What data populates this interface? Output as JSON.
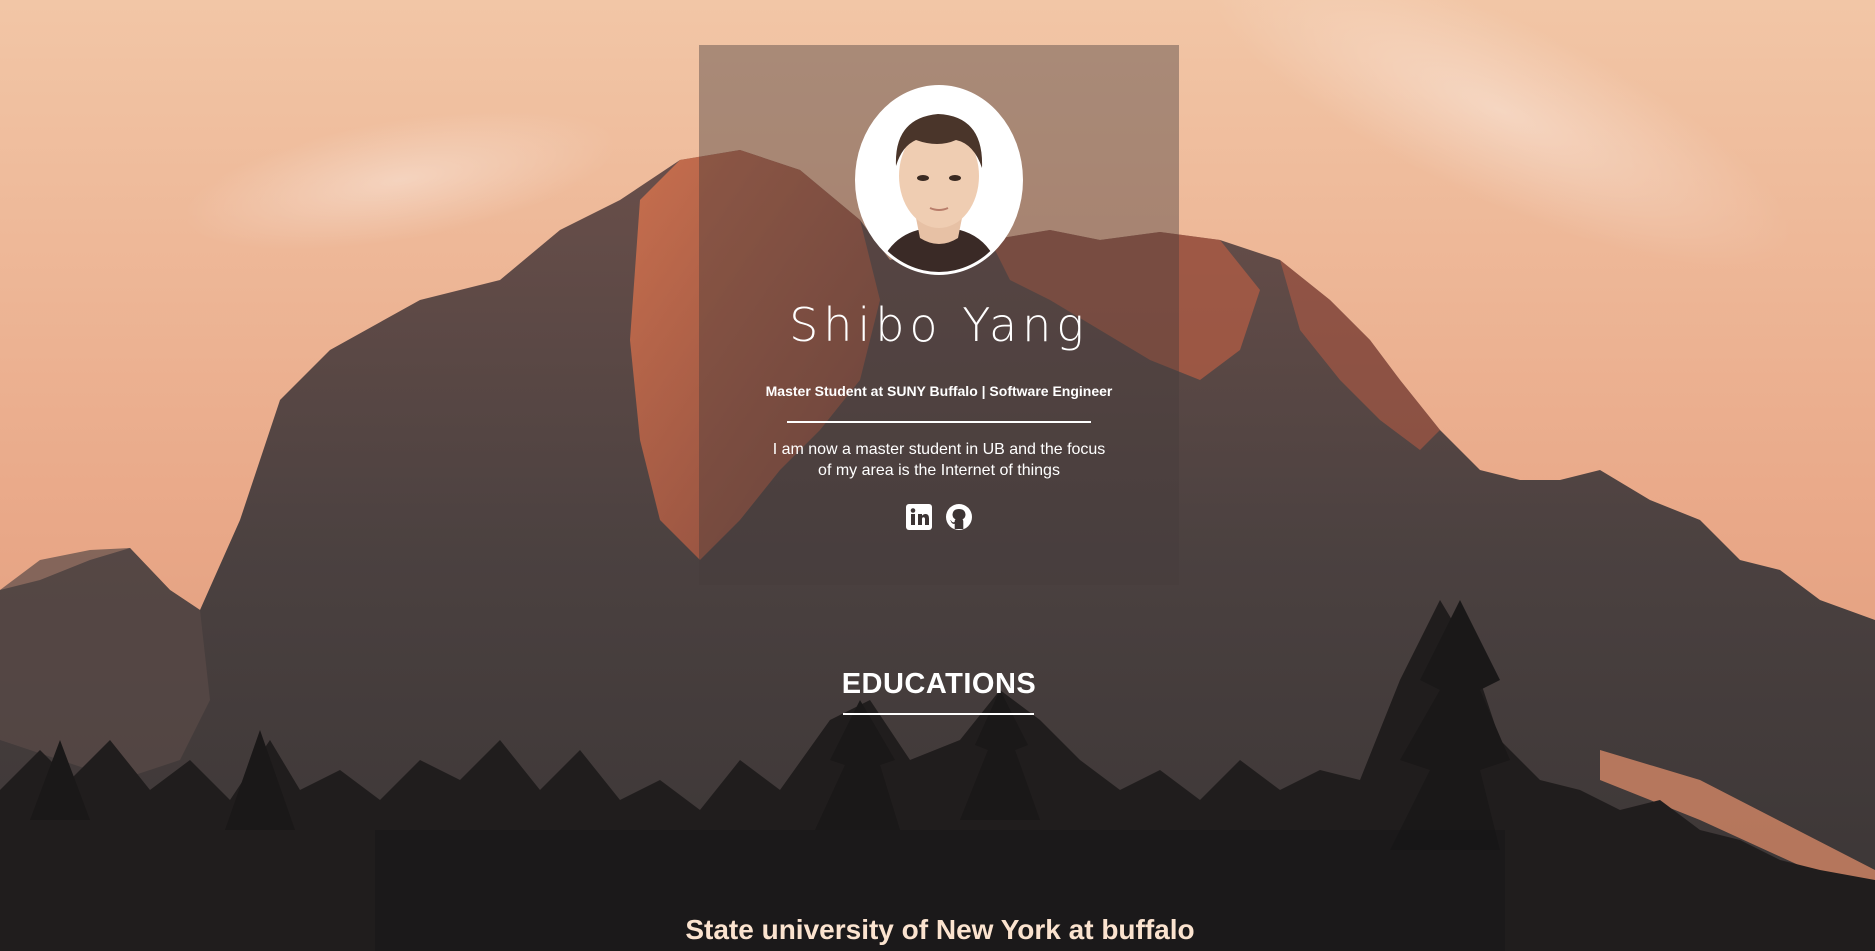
{
  "profile": {
    "name": "Shibo Yang",
    "subtitle": "Master Student at SUNY Buffalo | Software Engineer",
    "bio_line1": "I am now a master student in UB and the focus",
    "bio_line2": "of my area is the Internet of things",
    "social": [
      {
        "icon": "linkedin-icon"
      },
      {
        "icon": "github-icon"
      }
    ]
  },
  "educations": {
    "title": "EDUCATIONS",
    "school": "State university of New York at buffalo"
  },
  "colors": {
    "sky_top": "#f3c7a6",
    "sky_bottom": "#dd9a78",
    "rock": "#4a3f3e",
    "rock_lit": "#c8694c",
    "trees": "#1f1c1c",
    "school_text": "#fbe3cf"
  }
}
